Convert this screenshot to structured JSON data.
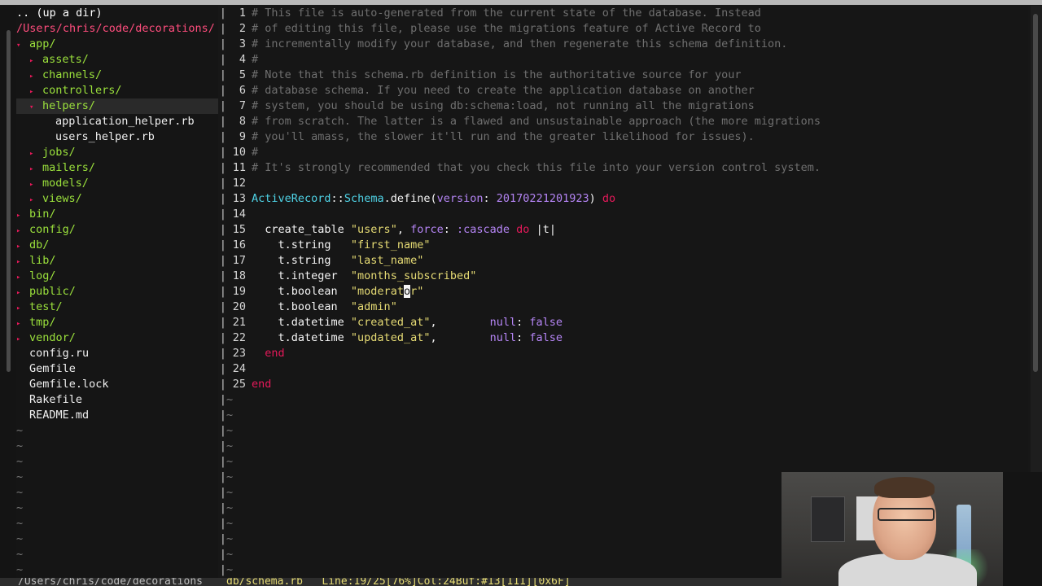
{
  "tree": {
    "updir": ".. (up a dir)",
    "root_path": "/Users/chris/code/decorations/",
    "items": [
      {
        "indent": 0,
        "arrow": "▾",
        "label": "app/",
        "type": "dir",
        "selected": false
      },
      {
        "indent": 1,
        "arrow": "▸",
        "label": "assets/",
        "type": "dir",
        "selected": false
      },
      {
        "indent": 1,
        "arrow": "▸",
        "label": "channels/",
        "type": "dir",
        "selected": false
      },
      {
        "indent": 1,
        "arrow": "▸",
        "label": "controllers/",
        "type": "dir",
        "selected": false
      },
      {
        "indent": 1,
        "arrow": "▾",
        "label": "helpers/",
        "type": "dir",
        "selected": true
      },
      {
        "indent": 2,
        "arrow": "",
        "label": "application_helper.rb",
        "type": "file",
        "selected": false
      },
      {
        "indent": 2,
        "arrow": "",
        "label": "users_helper.rb",
        "type": "file",
        "selected": false
      },
      {
        "indent": 1,
        "arrow": "▸",
        "label": "jobs/",
        "type": "dir",
        "selected": false
      },
      {
        "indent": 1,
        "arrow": "▸",
        "label": "mailers/",
        "type": "dir",
        "selected": false
      },
      {
        "indent": 1,
        "arrow": "▸",
        "label": "models/",
        "type": "dir",
        "selected": false
      },
      {
        "indent": 1,
        "arrow": "▸",
        "label": "views/",
        "type": "dir",
        "selected": false
      },
      {
        "indent": 0,
        "arrow": "▸",
        "label": "bin/",
        "type": "dir",
        "selected": false
      },
      {
        "indent": 0,
        "arrow": "▸",
        "label": "config/",
        "type": "dir",
        "selected": false
      },
      {
        "indent": 0,
        "arrow": "▸",
        "label": "db/",
        "type": "dir",
        "selected": false
      },
      {
        "indent": 0,
        "arrow": "▸",
        "label": "lib/",
        "type": "dir",
        "selected": false
      },
      {
        "indent": 0,
        "arrow": "▸",
        "label": "log/",
        "type": "dir",
        "selected": false
      },
      {
        "indent": 0,
        "arrow": "▸",
        "label": "public/",
        "type": "dir",
        "selected": false
      },
      {
        "indent": 0,
        "arrow": "▸",
        "label": "test/",
        "type": "dir",
        "selected": false
      },
      {
        "indent": 0,
        "arrow": "▸",
        "label": "tmp/",
        "type": "dir",
        "selected": false
      },
      {
        "indent": 0,
        "arrow": "▸",
        "label": "vendor/",
        "type": "dir",
        "selected": false
      },
      {
        "indent": 0,
        "arrow": "",
        "label": "config.ru",
        "type": "file",
        "selected": false
      },
      {
        "indent": 0,
        "arrow": "",
        "label": "Gemfile",
        "type": "file",
        "selected": false
      },
      {
        "indent": 0,
        "arrow": "",
        "label": "Gemfile.lock",
        "type": "file",
        "selected": false
      },
      {
        "indent": 0,
        "arrow": "",
        "label": "Rakefile",
        "type": "file",
        "selected": false
      },
      {
        "indent": 0,
        "arrow": "",
        "label": "README.md",
        "type": "file",
        "selected": false
      }
    ],
    "empty_marker": "~"
  },
  "editor": {
    "empty_marker": "~",
    "lines": [
      {
        "n": "1",
        "tokens": [
          {
            "c": "comment",
            "t": "# This file is auto-generated from the current state of the database. Instead"
          }
        ]
      },
      {
        "n": "2",
        "tokens": [
          {
            "c": "comment",
            "t": "# of editing this file, please use the migrations feature of Active Record to"
          }
        ]
      },
      {
        "n": "3",
        "tokens": [
          {
            "c": "comment",
            "t": "# incrementally modify your database, and then regenerate this schema definition."
          }
        ]
      },
      {
        "n": "4",
        "tokens": [
          {
            "c": "comment",
            "t": "#"
          }
        ]
      },
      {
        "n": "5",
        "tokens": [
          {
            "c": "comment",
            "t": "# Note that this schema.rb definition is the authoritative source for your"
          }
        ]
      },
      {
        "n": "6",
        "tokens": [
          {
            "c": "comment",
            "t": "# database schema. If you need to create the application database on another"
          }
        ]
      },
      {
        "n": "7",
        "tokens": [
          {
            "c": "comment",
            "t": "# system, you should be using db:schema:load, not running all the migrations"
          }
        ]
      },
      {
        "n": "8",
        "tokens": [
          {
            "c": "comment",
            "t": "# from scratch. The latter is a flawed and unsustainable approach (the more migrations"
          }
        ]
      },
      {
        "n": "9",
        "tokens": [
          {
            "c": "comment",
            "t": "# you'll amass, the slower it'll run and the greater likelihood for issues)."
          }
        ]
      },
      {
        "n": "10",
        "tokens": [
          {
            "c": "comment",
            "t": "#"
          }
        ]
      },
      {
        "n": "11",
        "tokens": [
          {
            "c": "comment",
            "t": "# It's strongly recommended that you check this file into your version control system."
          }
        ]
      },
      {
        "n": "12",
        "tokens": []
      },
      {
        "n": "13",
        "tokens": [
          {
            "c": "const",
            "t": "ActiveRecord"
          },
          {
            "c": "plain",
            "t": "::"
          },
          {
            "c": "const",
            "t": "Schema"
          },
          {
            "c": "method",
            "t": ".define("
          },
          {
            "c": "sym",
            "t": "version"
          },
          {
            "c": "plain",
            "t": ": "
          },
          {
            "c": "num",
            "t": "20170221201923"
          },
          {
            "c": "plain",
            "t": ") "
          },
          {
            "c": "kw",
            "t": "do"
          }
        ]
      },
      {
        "n": "14",
        "tokens": []
      },
      {
        "n": "15",
        "tokens": [
          {
            "c": "plain",
            "t": "  create_table "
          },
          {
            "c": "str",
            "t": "\"users\""
          },
          {
            "c": "plain",
            "t": ", "
          },
          {
            "c": "sym",
            "t": "force"
          },
          {
            "c": "plain",
            "t": ": "
          },
          {
            "c": "sym",
            "t": ":cascade"
          },
          {
            "c": "plain",
            "t": " "
          },
          {
            "c": "kw",
            "t": "do"
          },
          {
            "c": "plain",
            "t": " |t|"
          }
        ]
      },
      {
        "n": "16",
        "tokens": [
          {
            "c": "plain",
            "t": "    t.string   "
          },
          {
            "c": "str",
            "t": "\"first_name\""
          }
        ]
      },
      {
        "n": "17",
        "tokens": [
          {
            "c": "plain",
            "t": "    t.string   "
          },
          {
            "c": "str",
            "t": "\"last_name\""
          }
        ]
      },
      {
        "n": "18",
        "tokens": [
          {
            "c": "plain",
            "t": "    t.integer  "
          },
          {
            "c": "str",
            "t": "\"months_subscribed\""
          }
        ]
      },
      {
        "n": "19",
        "tokens": [
          {
            "c": "plain",
            "t": "    t.boolean  "
          },
          {
            "c": "str",
            "t": "\"moderat"
          },
          {
            "c": "cursor",
            "t": "o"
          },
          {
            "c": "str",
            "t": "r\""
          }
        ]
      },
      {
        "n": "20",
        "tokens": [
          {
            "c": "plain",
            "t": "    t.boolean  "
          },
          {
            "c": "str",
            "t": "\"admin\""
          }
        ]
      },
      {
        "n": "21",
        "tokens": [
          {
            "c": "plain",
            "t": "    t.datetime "
          },
          {
            "c": "str",
            "t": "\"created_at\""
          },
          {
            "c": "plain",
            "t": ",        "
          },
          {
            "c": "sym",
            "t": "null"
          },
          {
            "c": "plain",
            "t": ": "
          },
          {
            "c": "num",
            "t": "false"
          }
        ]
      },
      {
        "n": "22",
        "tokens": [
          {
            "c": "plain",
            "t": "    t.datetime "
          },
          {
            "c": "str",
            "t": "\"updated_at\""
          },
          {
            "c": "plain",
            "t": ",        "
          },
          {
            "c": "sym",
            "t": "null"
          },
          {
            "c": "plain",
            "t": ": "
          },
          {
            "c": "num",
            "t": "false"
          }
        ]
      },
      {
        "n": "23",
        "tokens": [
          {
            "c": "kw",
            "t": "  end"
          }
        ]
      },
      {
        "n": "24",
        "tokens": []
      },
      {
        "n": "25",
        "tokens": [
          {
            "c": "kw",
            "t": "end"
          }
        ]
      }
    ]
  },
  "statusbar": {
    "left": "/Users/chris/code/decorations",
    "right": "db/schema.rb   Line:19/25[76%]Col:24Buf:#13[111][0x6F]"
  },
  "colors": {
    "comment": "#6f6f6f",
    "keyword": "#e6195a",
    "string": "#e6db74",
    "constant": "#4fd3e6",
    "symbol": "#b585f5",
    "directory": "#9be13c",
    "root_path": "#ff4d7d"
  }
}
